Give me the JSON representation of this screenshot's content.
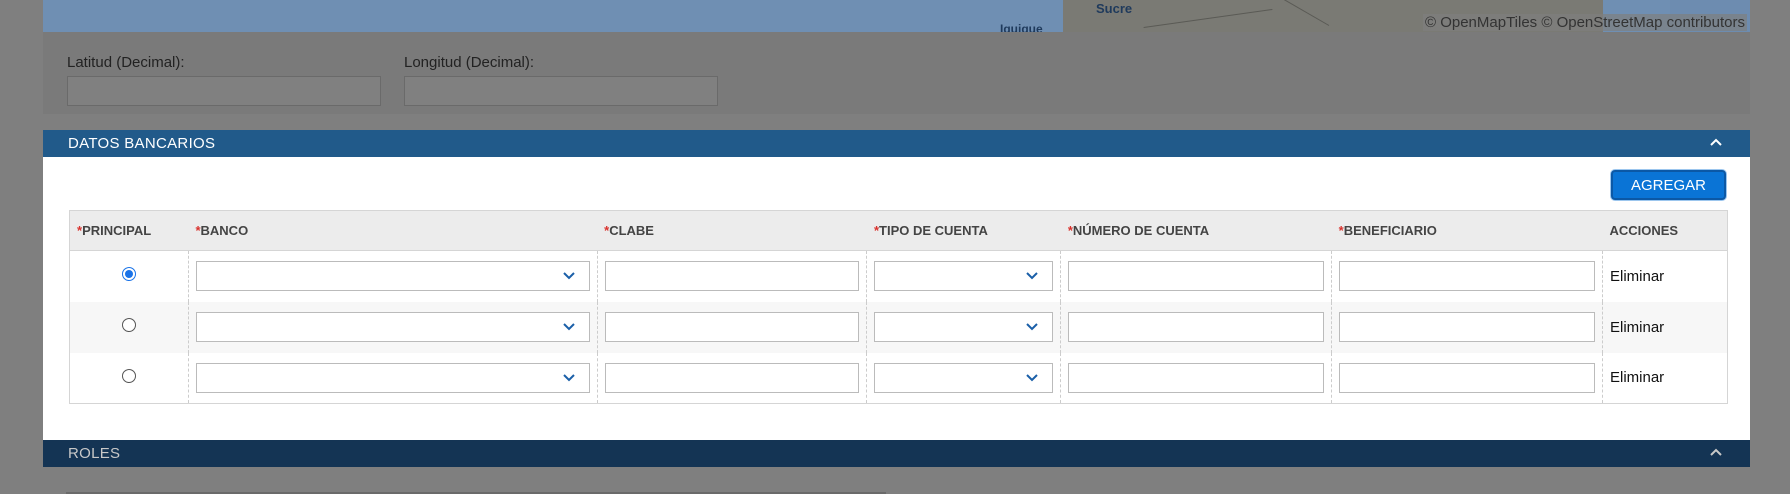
{
  "map": {
    "place_sucre": "Sucre",
    "place_iquique": "Iquique",
    "attribution": "© OpenMapTiles © OpenStreetMap contributors"
  },
  "coords": {
    "lat_label": "Latitud (Decimal):",
    "lng_label": "Longitud (Decimal):",
    "lat_value": "",
    "lng_value": ""
  },
  "bank_section": {
    "title": "DATOS BANCARIOS",
    "add_label": "AGREGAR",
    "required_mark": "*",
    "columns": [
      "PRINCIPAL",
      "BANCO",
      "CLABE",
      "TIPO DE CUENTA",
      "NÚMERO DE CUENTA",
      "BENEFICIARIO",
      "ACCIONES"
    ],
    "rows": [
      {
        "principal": true,
        "banco": "",
        "clabe": "",
        "tipo": "",
        "numero": "",
        "beneficiario": "",
        "accion": "Eliminar"
      },
      {
        "principal": false,
        "banco": "",
        "clabe": "",
        "tipo": "",
        "numero": "",
        "beneficiario": "",
        "accion": "Eliminar"
      },
      {
        "principal": false,
        "banco": "",
        "clabe": "",
        "tipo": "",
        "numero": "",
        "beneficiario": "",
        "accion": "Eliminar"
      }
    ]
  },
  "roles_section": {
    "title": "ROLES"
  },
  "icons": {
    "collapse": "chevron-up-icon",
    "dropdown": "chevron-down-icon"
  },
  "colors": {
    "header_blue": "#215a8a",
    "button_blue": "#0a74d6",
    "required_red": "#d9322d"
  }
}
